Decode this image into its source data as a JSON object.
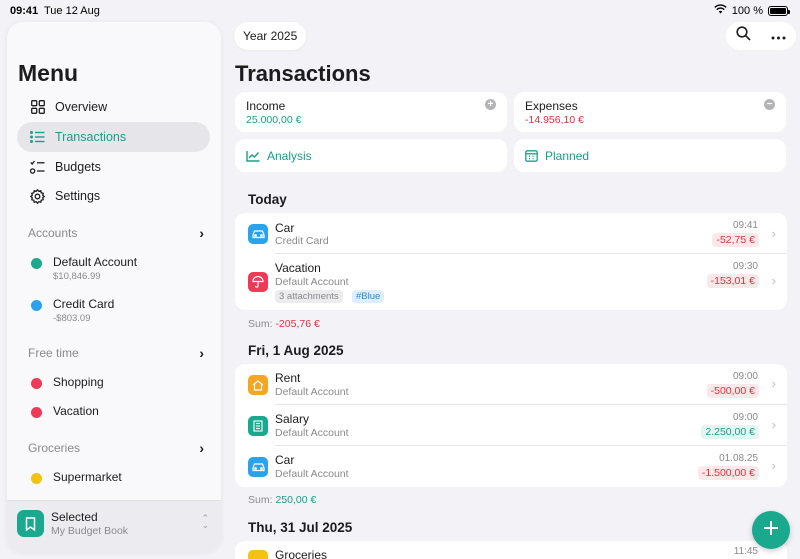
{
  "status": {
    "time": "09:41",
    "date": "Tue 12 Aug",
    "battery": "100 %"
  },
  "sidebar": {
    "title": "Menu",
    "nav": [
      {
        "label": "Overview",
        "icon": "grid-icon"
      },
      {
        "label": "Transactions",
        "icon": "list-icon",
        "active": true
      },
      {
        "label": "Budgets",
        "icon": "checklist-icon"
      },
      {
        "label": "Settings",
        "icon": "gear-icon"
      }
    ],
    "sections": [
      {
        "title": "Accounts",
        "items": [
          {
            "name": "Default Account",
            "sub": "$10,846.99",
            "color": "#1aa88e"
          },
          {
            "name": "Credit Card",
            "sub": "-$803.09",
            "color": "#2ba3ec"
          }
        ]
      },
      {
        "title": "Free time",
        "items": [
          {
            "name": "Shopping",
            "color": "#ee3a57"
          },
          {
            "name": "Vacation",
            "color": "#ee3a57"
          }
        ]
      },
      {
        "title": "Groceries",
        "items": [
          {
            "name": "Supermarket",
            "color": "#f5c211"
          }
        ]
      }
    ],
    "selected": {
      "title": "Selected",
      "book": "My Budget Book"
    }
  },
  "header": {
    "year": "Year 2025",
    "title": "Transactions"
  },
  "summary": {
    "income": {
      "label": "Income",
      "value": "25.000,00 €"
    },
    "expenses": {
      "label": "Expenses",
      "value": "-14.956,10 €"
    },
    "analysis": "Analysis",
    "planned": "Planned"
  },
  "groups": [
    {
      "day": "Today",
      "sum_label": "Sum:",
      "sum": "-205,76 €",
      "transactions": [
        {
          "name": "Car",
          "account": "Credit Card",
          "time": "09:41",
          "amount": "-52,75 €",
          "icon": "car-icon",
          "icon_color": "#2ba3ec"
        },
        {
          "name": "Vacation",
          "account": "Default Account",
          "time": "09:30",
          "amount": "-153,01 €",
          "icon": "umbrella-icon",
          "icon_color": "#ee3a57",
          "tags": [
            "3 attachments",
            "#Blue"
          ]
        }
      ]
    },
    {
      "day": "Fri, 1 Aug 2025",
      "sum_label": "Sum:",
      "sum": "250,00 €",
      "transactions": [
        {
          "name": "Rent",
          "account": "Default Account",
          "time": "09:00",
          "amount": "-500,00 €",
          "icon": "house-icon",
          "icon_color": "#f5a623"
        },
        {
          "name": "Salary",
          "account": "Default Account",
          "time": "09:00",
          "amount": "2.250,00 €",
          "icon": "building-icon",
          "icon_color": "#1aa88e"
        },
        {
          "name": "Car",
          "account": "Default Account",
          "time": "01.08.25",
          "amount": "-1.500,00 €",
          "icon": "car-icon",
          "icon_color": "#2ba3ec"
        }
      ]
    },
    {
      "day": "Thu, 31 Jul 2025",
      "transactions": [
        {
          "name": "Groceries",
          "time": "11:45",
          "icon": "cart-icon",
          "icon_color": "#f5c211"
        }
      ]
    }
  ]
}
